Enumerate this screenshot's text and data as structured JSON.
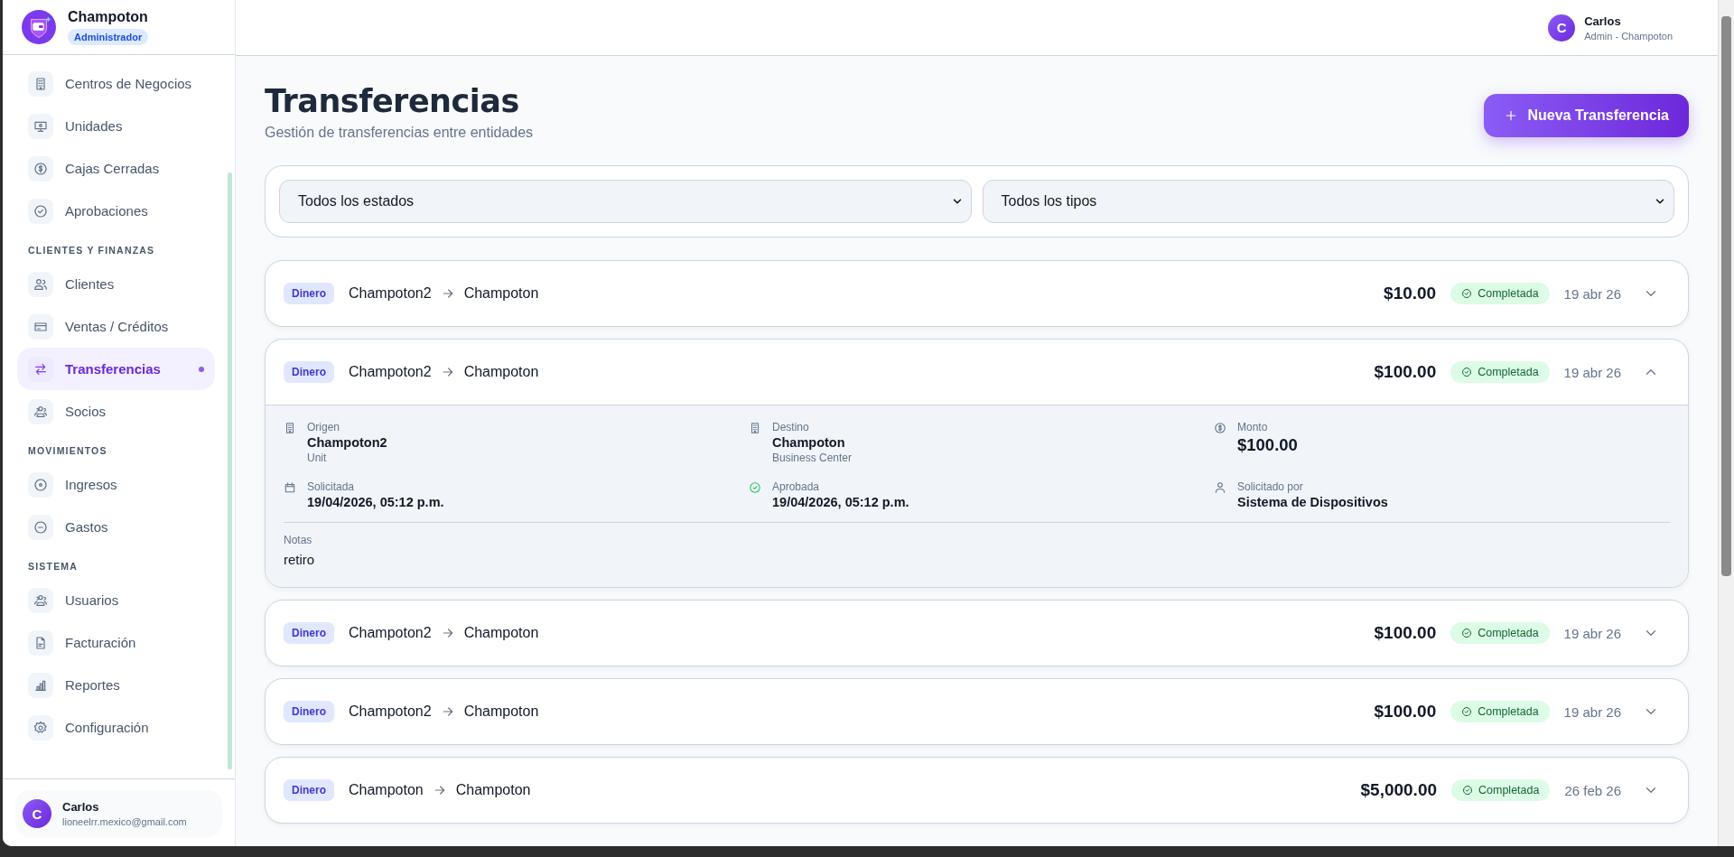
{
  "brand": {
    "name": "Champoton",
    "role": "Administrador"
  },
  "sidebar": {
    "sections": [
      {
        "items": [
          {
            "label": "Centros de Negocios",
            "selected": false
          },
          {
            "label": "Unidades",
            "selected": false
          },
          {
            "label": "Cajas Cerradas",
            "selected": false
          },
          {
            "label": "Aprobaciones",
            "selected": false
          }
        ]
      },
      {
        "title": "CLIENTES Y FINANZAS",
        "items": [
          {
            "label": "Clientes",
            "selected": false
          },
          {
            "label": "Ventas / Créditos",
            "selected": false
          },
          {
            "label": "Transferencias",
            "selected": true
          },
          {
            "label": "Socios",
            "selected": false
          }
        ]
      },
      {
        "title": "MOVIMIENTOS",
        "items": [
          {
            "label": "Ingresos",
            "selected": false
          },
          {
            "label": "Gastos",
            "selected": false
          }
        ]
      },
      {
        "title": "SISTEMA",
        "items": [
          {
            "label": "Usuarios",
            "selected": false
          },
          {
            "label": "Facturación",
            "selected": false
          },
          {
            "label": "Reportes",
            "selected": false
          },
          {
            "label": "Configuración",
            "selected": false
          }
        ]
      }
    ],
    "user": {
      "initial": "C",
      "name": "Carlos",
      "email": "lioneelrr.mexico@gmail.com"
    }
  },
  "header": {
    "user": {
      "initial": "C",
      "name": "Carlos",
      "subtitle": "Admin - Champoton"
    }
  },
  "page": {
    "title": "Transferencias",
    "subtitle": "Gestión de transferencias entre entidades",
    "new_button": "Nueva Transferencia"
  },
  "filters": [
    {
      "value": "Todos los estados"
    },
    {
      "value": "Todos los tipos"
    }
  ],
  "transfers": [
    {
      "type": "Dinero",
      "from": "Champoton2",
      "to": "Champoton",
      "amount": "$10.00",
      "status": "Completada",
      "date": "19 abr 26",
      "expanded": false
    },
    {
      "type": "Dinero",
      "from": "Champoton2",
      "to": "Champoton",
      "amount": "$100.00",
      "status": "Completada",
      "date": "19 abr 26",
      "expanded": true,
      "details": {
        "fields": [
          {
            "label": "Origen",
            "value": "Champoton2",
            "sub": "Unit",
            "kind": "text"
          },
          {
            "label": "Destino",
            "value": "Champoton",
            "sub": "Business Center",
            "kind": "text"
          },
          {
            "label": "Monto",
            "value": "$100.00",
            "kind": "amount"
          },
          {
            "label": "Solicitada",
            "value": "19/04/2026, 05:12 p.m.",
            "kind": "text"
          },
          {
            "label": "Aprobada",
            "value": "19/04/2026, 05:12 p.m.",
            "kind": "text"
          },
          {
            "label": "Solicitado por",
            "value": "Sistema de Dispositivos",
            "kind": "text"
          }
        ],
        "notes": {
          "label": "Notas",
          "value": "retiro"
        }
      }
    },
    {
      "type": "Dinero",
      "from": "Champoton2",
      "to": "Champoton",
      "amount": "$100.00",
      "status": "Completada",
      "date": "19 abr 26",
      "expanded": false
    },
    {
      "type": "Dinero",
      "from": "Champoton2",
      "to": "Champoton",
      "amount": "$100.00",
      "status": "Completada",
      "date": "19 abr 26",
      "expanded": false
    },
    {
      "type": "Dinero",
      "from": "Champoton",
      "to": "Champoton",
      "amount": "$5,000.00",
      "status": "Completada",
      "date": "26 feb 26",
      "expanded": false
    }
  ]
}
